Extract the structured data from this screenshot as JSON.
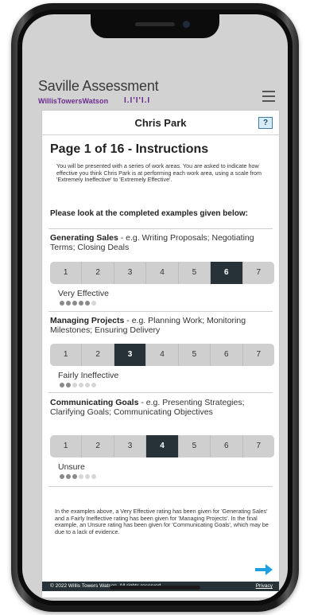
{
  "header": {
    "brand_title": "Saville Assessment",
    "brand_subtitle": "WillisTowersWatson",
    "brand_mark": "I.I'I'I.I"
  },
  "card": {
    "person_name": "Chris Park",
    "help_label": "?"
  },
  "page": {
    "title": "Page 1 of 16 - Instructions",
    "intro": "You will be presented with a series of work areas. You are asked to indicate how effective you think Chris Park is at performing each work area, using a scale from 'Extremely Ineffective' to 'Extremely Effective'.",
    "examples_heading": "Please look at the completed examples given below:"
  },
  "examples": [
    {
      "name": "Generating Sales",
      "detail": " - e.g. Writing Proposals; Negotiating Terms; Closing Deals",
      "scale": [
        "1",
        "2",
        "3",
        "4",
        "5",
        "6",
        "7"
      ],
      "selected": 6,
      "rating_label": "Very Effective"
    },
    {
      "name": "Managing Projects",
      "detail": " - e.g. Planning Work; Monitoring Milestones; Ensuring Delivery",
      "scale": [
        "1",
        "2",
        "3",
        "4",
        "5",
        "6",
        "7"
      ],
      "selected": 3,
      "rating_label": "Fairly Ineffective"
    },
    {
      "name": "Communicating Goals",
      "detail": " - e.g. Presenting Strategies; Clarifying Goals; Communicating Objectives",
      "scale": [
        "1",
        "2",
        "3",
        "4",
        "5",
        "6",
        "7"
      ],
      "selected": 4,
      "rating_label": "Unsure"
    }
  ],
  "summary": "In the examples above, a Very Effective rating has been given for 'Generating Sales' and a Fairly Ineffective rating has been given for 'Managing Projects'. In the final example, an Unsure rating has been given for 'Communicating Goals', which may be due to a lack of evidence.",
  "footer": {
    "copyright": "© 2022 Willis Towers Watson. All rights reserved.",
    "privacy": "Privacy"
  },
  "colors": {
    "selected": "#263238",
    "brand_purple": "#6b2a8e",
    "next_arrow": "#1ea0e0"
  },
  "icons": {
    "menu": "hamburger-menu-icon",
    "help": "help-icon",
    "next": "arrow-right-icon"
  }
}
